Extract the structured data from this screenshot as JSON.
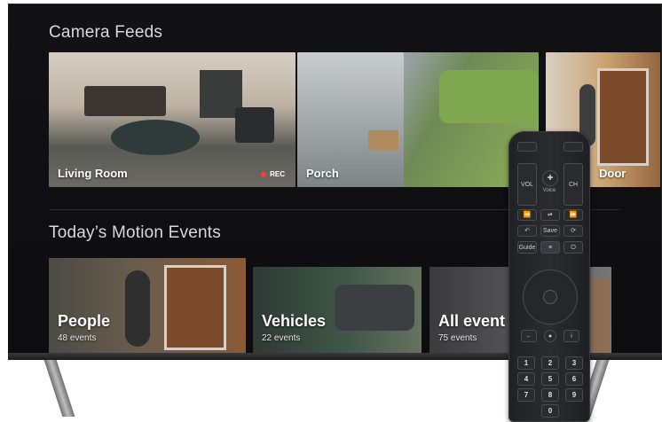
{
  "camera_feeds": {
    "title": "Camera Feeds",
    "tiles": [
      {
        "label": "Living Room",
        "rec": "REC"
      },
      {
        "label": "Porch"
      },
      {
        "label": "Door"
      }
    ]
  },
  "motion_events": {
    "title": "Today’s Motion Events",
    "tiles": [
      {
        "label": "People",
        "count": "48 events"
      },
      {
        "label": "Vehicles",
        "count": "22 events"
      },
      {
        "label": "All event",
        "count": "75 events"
      }
    ]
  },
  "remote": {
    "vol": "VOL",
    "ch": "CH",
    "voice": "Voice",
    "menu_label": "Guide",
    "save": "Save",
    "keys": [
      "1",
      "2",
      "3",
      "4",
      "5",
      "6",
      "7",
      "8",
      "9",
      "0"
    ]
  },
  "colors": {
    "rec_dot": "#ff3b3b",
    "screen_bg": "#121214"
  }
}
